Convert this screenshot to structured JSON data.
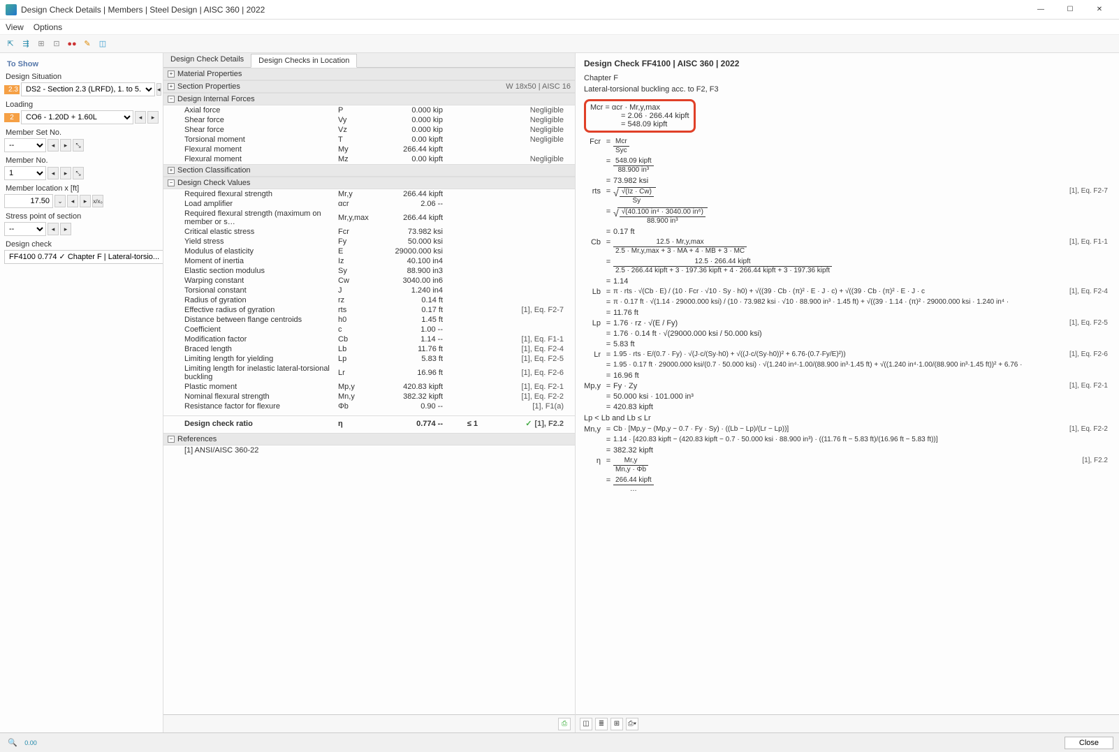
{
  "window": {
    "title": "Design Check Details | Members | Steel Design | AISC 360 | 2022"
  },
  "menu": {
    "view": "View",
    "options": "Options"
  },
  "sidebar": {
    "to_show": "To Show",
    "design_situation": "Design Situation",
    "ds_badge": "2.3",
    "ds_value": "DS2 - Section 2.3 (LRFD), 1. to 5.",
    "loading": "Loading",
    "load_badge": "2",
    "load_value": "CO6 - 1.20D + 1.60L",
    "member_set_no": "Member Set No.",
    "member_set_value": "-- ",
    "member_no": "Member No.",
    "member_no_value": "1 ",
    "member_location": "Member location x [ft]",
    "member_loc_value": "17.50",
    "stress_point": "Stress point of section",
    "stress_point_value": "-- ",
    "design_check": "Design check",
    "design_check_value": "FF4100  0.774  ✓  Chapter F | Lateral-torsio..."
  },
  "center_tabs": {
    "t1": "Design Check Details",
    "t2": "Design Checks in Location"
  },
  "groups": {
    "material": "Material Properties",
    "section_props": "Section Properties",
    "section_props_right": "W 18x50 | AISC 16",
    "dif": "Design Internal Forces",
    "sc": "Section Classification",
    "dcv": "Design Check Values",
    "refs": "References",
    "ref1": "[1] ANSI/AISC 360-22"
  },
  "forces": [
    {
      "label": "Axial force",
      "sym": "P",
      "val": "0.000 kip",
      "ref": "Negligible"
    },
    {
      "label": "Shear force",
      "sym": "Vy",
      "val": "0.000 kip",
      "ref": "Negligible"
    },
    {
      "label": "Shear force",
      "sym": "Vz",
      "val": "0.000 kip",
      "ref": "Negligible"
    },
    {
      "label": "Torsional moment",
      "sym": "T",
      "val": "0.00 kipft",
      "ref": "Negligible"
    },
    {
      "label": "Flexural moment",
      "sym": "My",
      "val": "266.44 kipft",
      "ref": ""
    },
    {
      "label": "Flexural moment",
      "sym": "Mz",
      "val": "0.00 kipft",
      "ref": "Negligible"
    }
  ],
  "dcv_rows": [
    {
      "label": "Required flexural strength",
      "sym": "Mr,y",
      "val": "266.44 kipft",
      "ref": ""
    },
    {
      "label": "Load amplifier",
      "sym": "αcr",
      "val": "2.06 --",
      "ref": ""
    },
    {
      "label": "Required flexural strength (maximum on member or s…",
      "sym": "Mr,y,max",
      "val": "266.44 kipft",
      "ref": ""
    },
    {
      "label": "Critical elastic stress",
      "sym": "Fcr",
      "val": "73.982 ksi",
      "ref": ""
    },
    {
      "label": "Yield stress",
      "sym": "Fy",
      "val": "50.000 ksi",
      "ref": ""
    },
    {
      "label": "Modulus of elasticity",
      "sym": "E",
      "val": "29000.000 ksi",
      "ref": ""
    },
    {
      "label": "Moment of inertia",
      "sym": "Iz",
      "val": "40.100 in4",
      "ref": ""
    },
    {
      "label": "Elastic section modulus",
      "sym": "Sy",
      "val": "88.900 in3",
      "ref": ""
    },
    {
      "label": "Warping constant",
      "sym": "Cw",
      "val": "3040.00 in6",
      "ref": ""
    },
    {
      "label": "Torsional constant",
      "sym": "J",
      "val": "1.240 in4",
      "ref": ""
    },
    {
      "label": "Radius of gyration",
      "sym": "rz",
      "val": "0.14 ft",
      "ref": ""
    },
    {
      "label": "Effective radius of gyration",
      "sym": "rts",
      "val": "0.17 ft",
      "ref": "[1], Eq. F2-7"
    },
    {
      "label": "Distance between flange centroids",
      "sym": "h0",
      "val": "1.45 ft",
      "ref": ""
    },
    {
      "label": "Coefficient",
      "sym": "c",
      "val": "1.00 --",
      "ref": ""
    },
    {
      "label": "Modification factor",
      "sym": "Cb",
      "val": "1.14 --",
      "ref": "[1], Eq. F1-1"
    },
    {
      "label": "Braced length",
      "sym": "Lb",
      "val": "11.76 ft",
      "ref": "[1], Eq. F2-4"
    },
    {
      "label": "Limiting length for yielding",
      "sym": "Lp",
      "val": "5.83 ft",
      "ref": "[1], Eq. F2-5"
    },
    {
      "label": "Limiting length for inelastic lateral-torsional buckling",
      "sym": "Lr",
      "val": "16.96 ft",
      "ref": "[1], Eq. F2-6"
    },
    {
      "label": "Plastic moment",
      "sym": "Mp,y",
      "val": "420.83 kipft",
      "ref": "[1], Eq. F2-1"
    },
    {
      "label": "Nominal flexural strength",
      "sym": "Mn,y",
      "val": "382.32 kipft",
      "ref": "[1], Eq. F2-2"
    },
    {
      "label": "Resistance factor for flexure",
      "sym": "Φb",
      "val": "0.90 --",
      "ref": "[1], F1(a)"
    }
  ],
  "dcv_ratio": {
    "label": "Design check ratio",
    "sym": "η",
    "val": "0.774 --",
    "limit": "≤ 1",
    "ref": "[1], F2.2"
  },
  "rp": {
    "title": "Design Check FF4100 | AISC 360 | 2022",
    "chapter": "Chapter F",
    "sub": "Lateral-torsional buckling acc. to F2, F3",
    "mcr_l1": "Mcr   =   αcr  ·  Mr,y,max",
    "mcr_l2": "=   2.06  ·  266.44 kipft",
    "mcr_l3": "=   548.09 kipft",
    "fcr_lhs": "Fcr",
    "fcr_eq": "=",
    "fcr_num": "Mcr",
    "fcr_den": "Syc",
    "fcr_num2": "548.09 kipft",
    "fcr_den2": "88.900 in³",
    "fcr_res": "73.982 ksi",
    "rts_lhs": "rts",
    "ref_f27": "[1], Eq. F2-7",
    "rts_num1": "√(Iz · Cw)",
    "rts_den1": "Sy",
    "rts_num2": "√(40.100 in⁴ · 3040.00 in⁶)",
    "rts_den2": "88.900 in³",
    "rts_res": "0.17 ft",
    "cb_lhs": "Cb",
    "ref_f11": "[1], Eq. F1-1",
    "cb_num": "12.5 · Mr,y,max",
    "cb_den": "2.5 · Mr,y,max + 3 · MA + 4 · MB + 3 · MC",
    "cb_num2": "12.5 · 266.44 kipft",
    "cb_den2": "2.5 · 266.44 kipft + 3 · 197.36 kipft + 4 · 266.44 kipft + 3 · 197.36 kipft",
    "cb_res": "1.14",
    "lb_lhs": "Lb",
    "ref_f24": "[1], Eq. F2-4",
    "lb_expr": "π · rts · √(Cb · E)  /  (10 · Fcr · √10 · Sy · h0)  +  √((39 · Cb · (π)² · E · J · c) + √((39 · Cb · (π)² · E · J · c",
    "lb_expr2": "π · 0.17 ft · √(1.14 · 29000.000 ksi) / (10 · 73.982 ksi · √10 · 88.900 in³ · 1.45 ft) + √((39 · 1.14 · (π)² · 29000.000 ksi · 1.240 in⁴ · ",
    "lb_res": "11.76 ft",
    "lp_lhs": "Lp",
    "ref_f25": "[1], Eq. F2-5",
    "lp_expr": "1.76 · rz · √(E / Fy)",
    "lp_expr2": "1.76 · 0.14 ft · √(29000.000 ksi / 50.000 ksi)",
    "lp_res": "5.83 ft",
    "lr_lhs": "Lr",
    "ref_f26": "[1], Eq. F2-6",
    "lr_expr": "1.95 · rts · E/(0.7 · Fy) · √(J·c/(Sy·h0) + √((J·c/(Sy·h0))² + 6.76·(0.7·Fy/E)²))",
    "lr_expr2": "1.95 · 0.17 ft · 29000.000 ksi/(0.7 · 50.000 ksi) · √(1.240 in⁴·1.00/(88.900 in³·1.45 ft) + √((1.240 in⁴·1.00/(88.900 in³·1.45 ft))² + 6.76 · ",
    "lr_res": "16.96 ft",
    "mpy_lhs": "Mp,y",
    "ref_f21": "[1], Eq. F2-1",
    "mpy_expr": "Fy · Zy",
    "mpy_expr2": "50.000 ksi · 101.000 in³",
    "mpy_res": "420.83 kipft",
    "lp_lb_lr": "Lp  <  Lb and Lb  ≤  Lr",
    "mny_lhs": "Mn,y",
    "ref_f22": "[1], Eq. F2-2",
    "mny_expr": "Cb · [Mp,y − (Mp,y − 0.7 · Fy · Sy) · ((Lb − Lp)/(Lr − Lp))]",
    "mny_expr2": "1.14 · [420.83 kipft − (420.83 kipft − 0.7 · 50.000 ksi · 88.900 in³) · ((11.76 ft − 5.83 ft)/(16.96 ft − 5.83 ft))]",
    "mny_res": "382.32 kipft",
    "eta_lhs": "η",
    "ref_f22b": "[1], F2.2",
    "eta_num": "Mr,y",
    "eta_den": "Mn,y · Φb",
    "eta_num2": "266.44 kipft"
  },
  "footer": {
    "close": "Close"
  }
}
